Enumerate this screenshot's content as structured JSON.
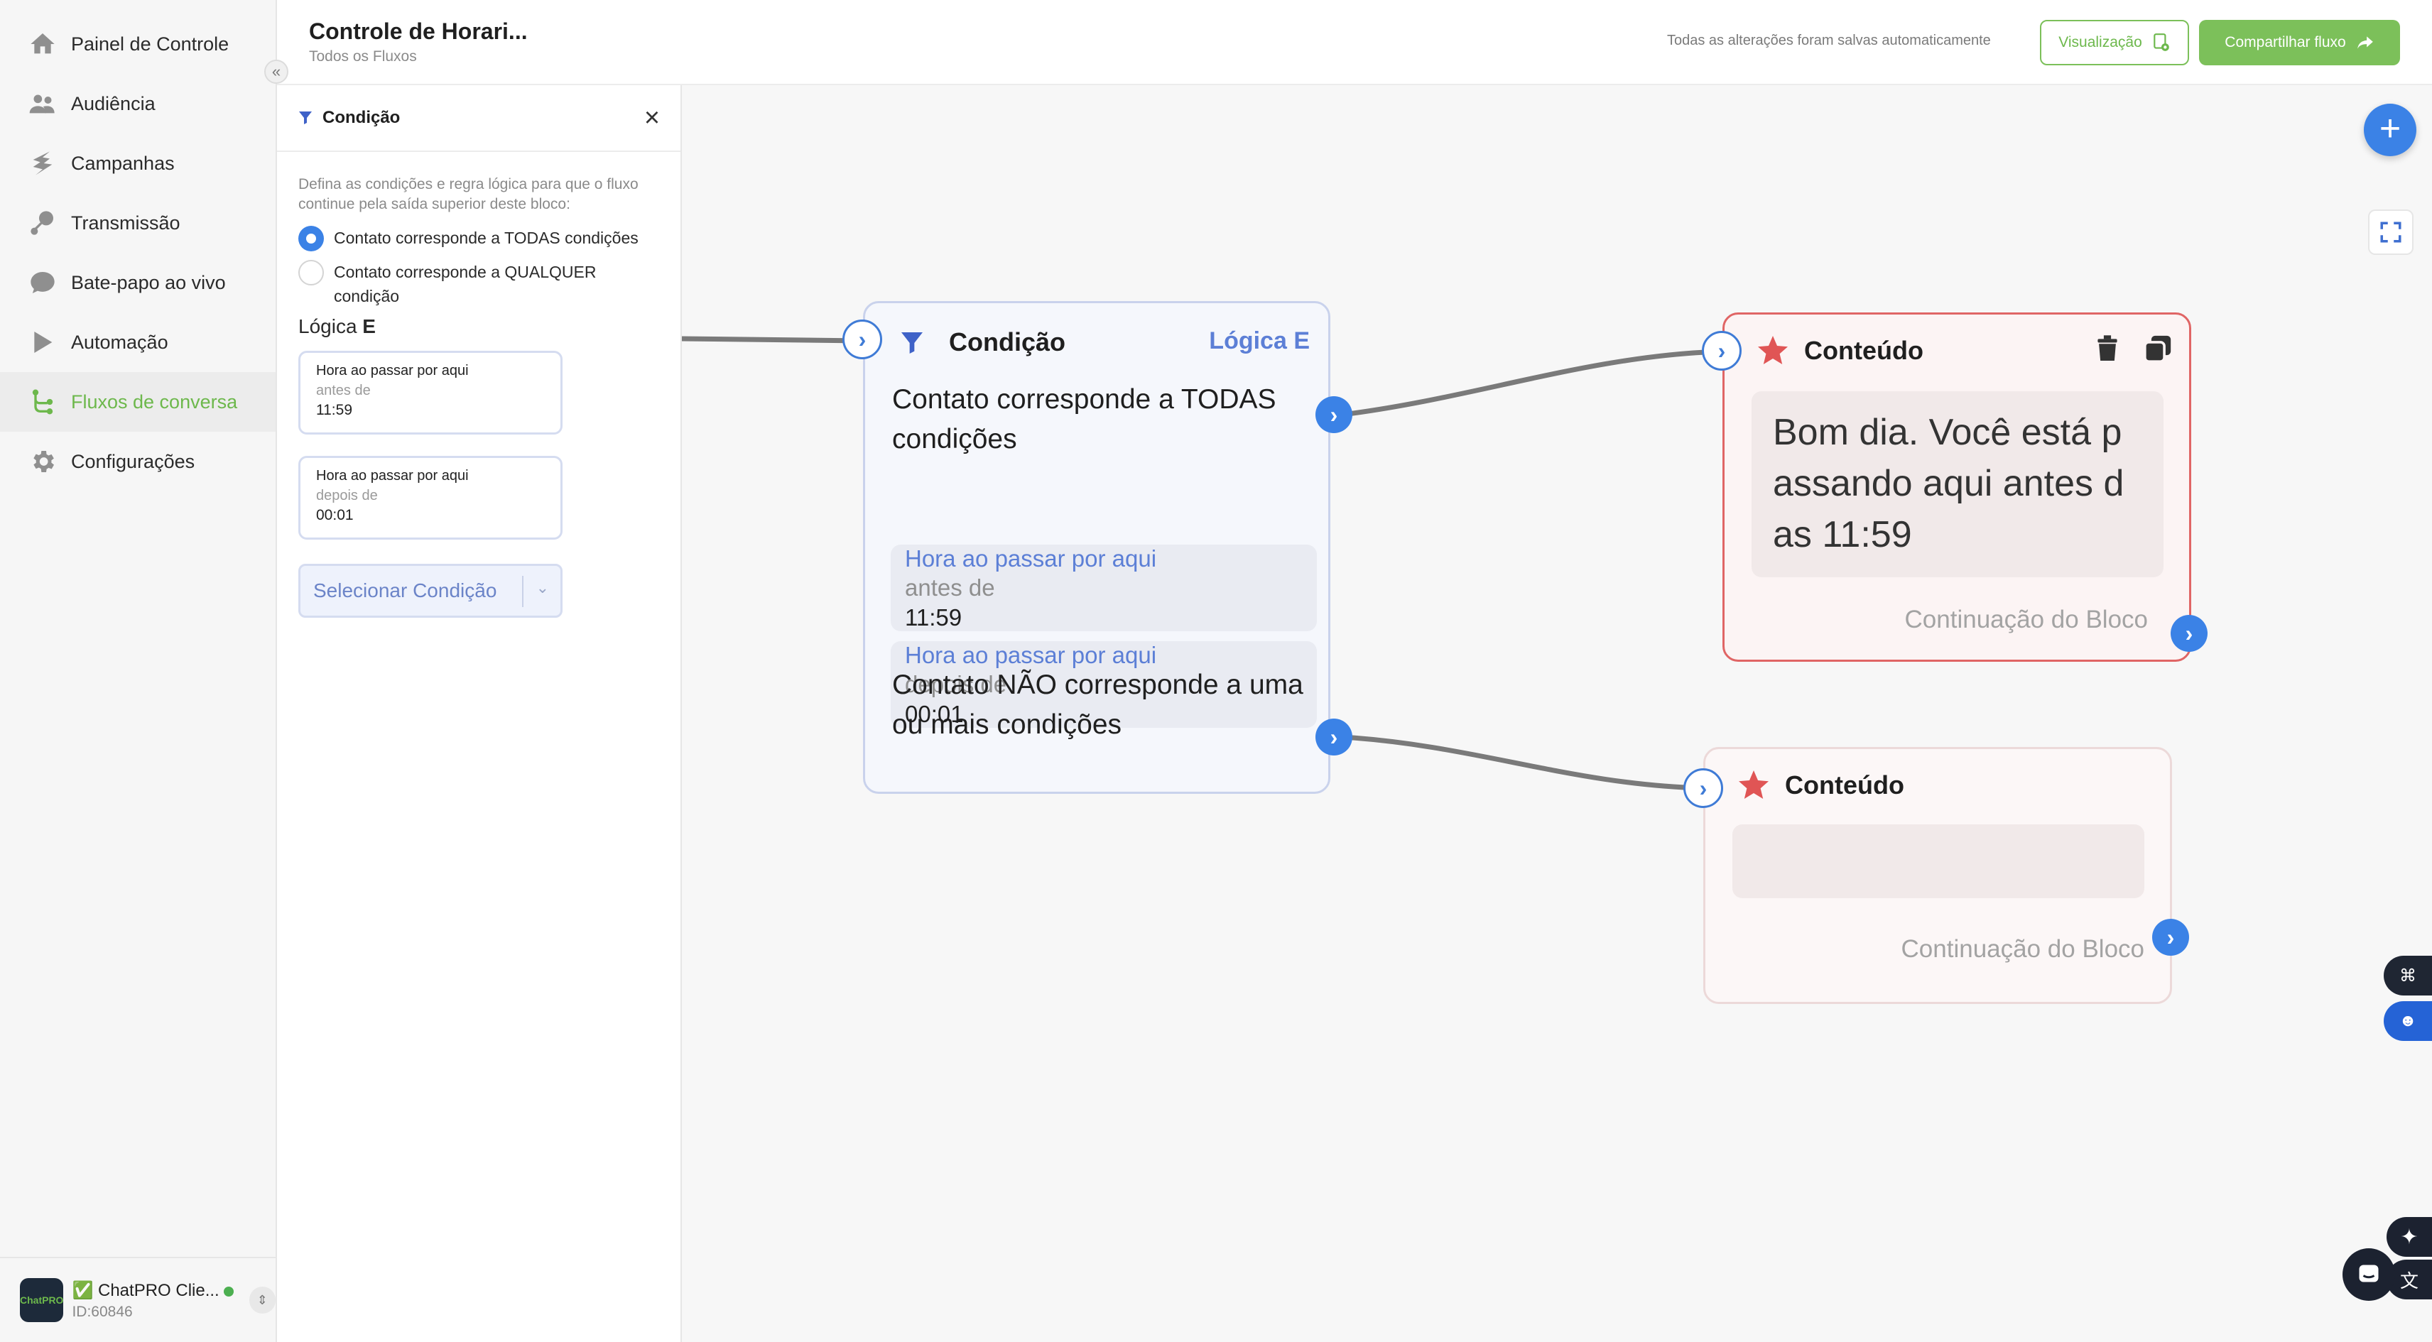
{
  "colors": {
    "accent_green": "#6db84c",
    "accent_blue": "#3b82e6",
    "condition_blue": "#5c7fd6",
    "content_red": "#e06565"
  },
  "sidebar": {
    "items": [
      {
        "label": "Painel de Controle",
        "icon": "home-icon"
      },
      {
        "label": "Audiência",
        "icon": "users-icon"
      },
      {
        "label": "Campanhas",
        "icon": "campaigns-icon"
      },
      {
        "label": "Transmissão",
        "icon": "broadcast-icon"
      },
      {
        "label": "Bate-papo ao vivo",
        "icon": "chat-icon"
      },
      {
        "label": "Automação",
        "icon": "automation-icon"
      },
      {
        "label": "Fluxos de conversa",
        "icon": "flow-icon",
        "active": true
      },
      {
        "label": "Configurações",
        "icon": "gear-icon"
      }
    ],
    "account": {
      "name": "✅ ChatPRO Clie...",
      "id": "ID:60846",
      "logo_text": "ChatPRO"
    }
  },
  "header": {
    "title": "Controle de Horari...",
    "breadcrumb": "Todos os Fluxos",
    "saved_status": "Todas as alterações foram salvas automaticamente",
    "preview_label": "Visualização",
    "share_label": "Compartilhar fluxo"
  },
  "panel": {
    "title": "Condição",
    "description": "Defina as condições e regra lógica para que o fluxo continue pela saída superior deste bloco:",
    "radio_all": "Contato corresponde a TODAS condições",
    "radio_any": "Contato corresponde a QUALQUER condição",
    "logic_prefix": "Lógica",
    "logic_value": "E",
    "conditions": [
      {
        "field": "Hora ao passar por aqui",
        "operator": "antes de",
        "value": "11:59"
      },
      {
        "field": "Hora ao passar por aqui",
        "operator": "depois de",
        "value": "00:01"
      }
    ],
    "select_placeholder": "Selecionar Condição"
  },
  "canvas": {
    "condition_node": {
      "title": "Condição",
      "logic": "Lógica E",
      "match_all": "Contato corresponde a TODAS condições",
      "chips": [
        {
          "field": "Hora ao passar por aqui",
          "operator": "antes de",
          "value": "11:59"
        },
        {
          "field": "Hora ao passar por aqui",
          "operator": "depois de",
          "value": "00:01"
        }
      ],
      "no_match": "Contato NÃO corresponde a uma ou mais condições"
    },
    "content_node_1": {
      "title": "Conteúdo",
      "message": "Bom dia. Você está passando aqui antes das 11:59",
      "continuation": "Continuação do Bloco"
    },
    "content_node_2": {
      "title": "Conteúdo",
      "message": "",
      "continuation": "Continuação do Bloco"
    }
  }
}
